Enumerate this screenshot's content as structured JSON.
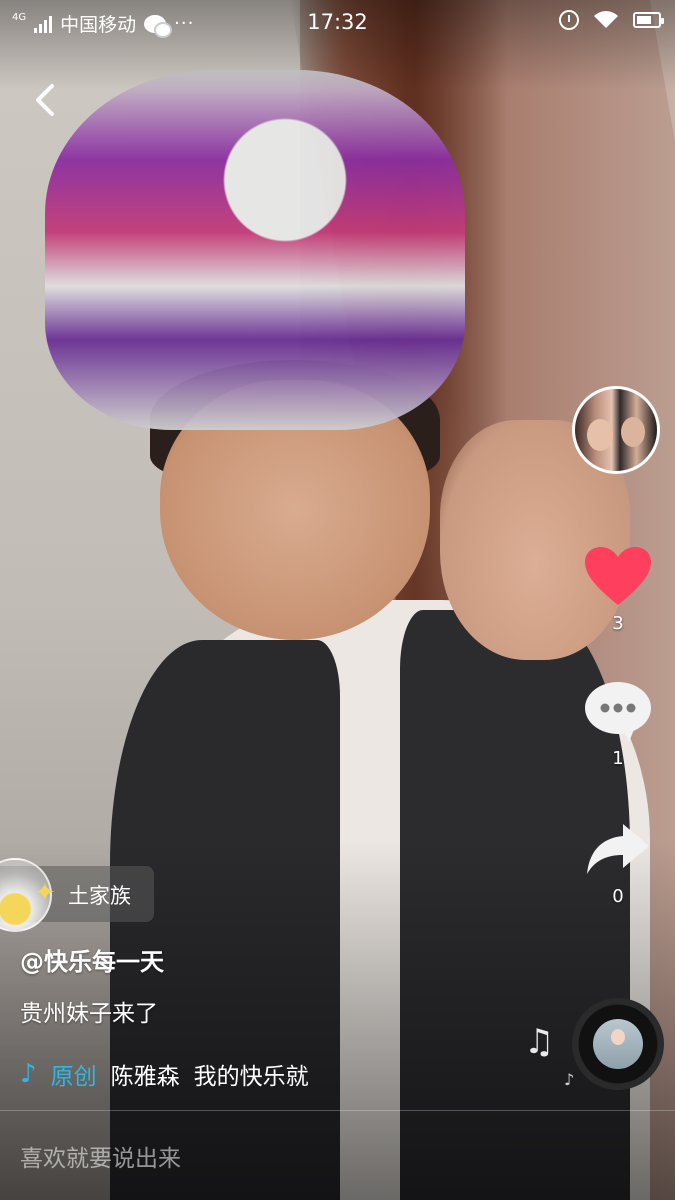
{
  "status_bar": {
    "network": "4G",
    "carrier": "中国移动",
    "dots": "···",
    "time": "17:32"
  },
  "icons": {
    "back": "back-arrow-icon",
    "like": "heart-icon",
    "comment": "comment-bubble-icon",
    "share": "share-arrow-icon",
    "music": "music-note-icon"
  },
  "colors": {
    "like": "#ff3f5e",
    "music_accent": "#2fb7e6"
  },
  "actions": {
    "like_count": "3",
    "comment_count": "1",
    "share_count": "0"
  },
  "video": {
    "location_tag": "土家族",
    "username": "@快乐每一天",
    "description": "贵州妹子来了",
    "music_label": "原创",
    "music_artist": "陈雅森",
    "music_title": "我的快乐就"
  },
  "comment_input": {
    "placeholder": "喜欢就要说出来"
  }
}
